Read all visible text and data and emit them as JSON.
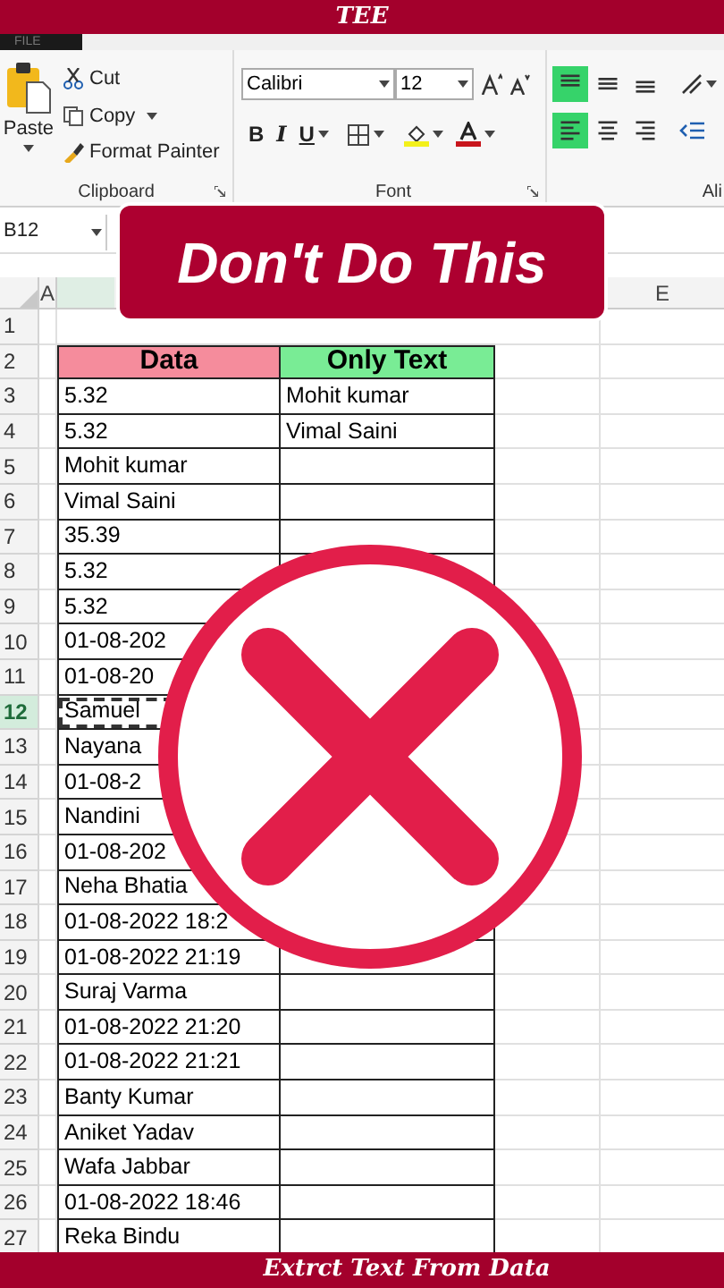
{
  "top_banner": {
    "title": "TEE"
  },
  "file_tab": "FILE",
  "clipboard": {
    "paste": "Paste",
    "cut": "Cut",
    "copy": "Copy",
    "format_painter": "Format Painter",
    "group_label": "Clipboard"
  },
  "font": {
    "family": "Calibri",
    "size": "12",
    "bold": "B",
    "italic": "I",
    "underline": "U",
    "group_label": "Font"
  },
  "alignment": {
    "top_row": [
      {
        "selected": true
      },
      {
        "selected": false
      },
      {
        "selected": false
      }
    ],
    "bottom_row": [
      {
        "selected": true
      },
      {
        "selected": false
      },
      {
        "selected": false
      }
    ],
    "group_label": "Ali"
  },
  "name_box": "B12",
  "column_headers": [
    "A",
    "E"
  ],
  "headline": "Don't Do This",
  "rows": [
    {
      "number": "1",
      "selected": false,
      "kind": "empty"
    },
    {
      "number": "2",
      "selected": false,
      "kind": "header",
      "data": "Data",
      "only_text": "Only Text"
    },
    {
      "number": "3",
      "selected": false,
      "kind": "data",
      "data": "5.32",
      "only_text": "Mohit kumar"
    },
    {
      "number": "4",
      "selected": false,
      "kind": "data",
      "data": "5.32",
      "only_text": "Vimal Saini"
    },
    {
      "number": "5",
      "selected": false,
      "kind": "data",
      "data": "Mohit kumar"
    },
    {
      "number": "6",
      "selected": false,
      "kind": "data",
      "data": "Vimal Saini"
    },
    {
      "number": "7",
      "selected": false,
      "kind": "data",
      "data": "35.39"
    },
    {
      "number": "8",
      "selected": false,
      "kind": "data",
      "data": "5.32"
    },
    {
      "number": "9",
      "selected": false,
      "kind": "data",
      "data": "5.32"
    },
    {
      "number": "10",
      "selected": false,
      "kind": "data",
      "data": "01-08-202"
    },
    {
      "number": "11",
      "selected": false,
      "kind": "data",
      "data": "01-08-20"
    },
    {
      "number": "12",
      "selected": true,
      "kind": "data",
      "data": "Samuel"
    },
    {
      "number": "13",
      "selected": false,
      "kind": "data",
      "data": "Nayana"
    },
    {
      "number": "14",
      "selected": false,
      "kind": "data",
      "data": "01-08-2"
    },
    {
      "number": "15",
      "selected": false,
      "kind": "data",
      "data": "Nandini"
    },
    {
      "number": "16",
      "selected": false,
      "kind": "data",
      "data": "01-08-202"
    },
    {
      "number": "17",
      "selected": false,
      "kind": "data",
      "data": "Neha Bhatia"
    },
    {
      "number": "18",
      "selected": false,
      "kind": "data",
      "data": "01-08-2022 18:2"
    },
    {
      "number": "19",
      "selected": false,
      "kind": "data",
      "data": "01-08-2022 21:19"
    },
    {
      "number": "20",
      "selected": false,
      "kind": "data",
      "data": "Suraj Varma"
    },
    {
      "number": "21",
      "selected": false,
      "kind": "data",
      "data": "01-08-2022 21:20"
    },
    {
      "number": "22",
      "selected": false,
      "kind": "data",
      "data": "01-08-2022 21:21"
    },
    {
      "number": "23",
      "selected": false,
      "kind": "data",
      "data": "Banty Kumar"
    },
    {
      "number": "24",
      "selected": false,
      "kind": "data",
      "data": "Aniket Yadav"
    },
    {
      "number": "25",
      "selected": false,
      "kind": "data",
      "data": "Wafa Jabbar"
    },
    {
      "number": "26",
      "selected": false,
      "kind": "data",
      "data": "01-08-2022 18:46"
    },
    {
      "number": "27",
      "selected": false,
      "kind": "data",
      "data": "Reka Bindu"
    }
  ],
  "footer": "Extrct Text From Data"
}
